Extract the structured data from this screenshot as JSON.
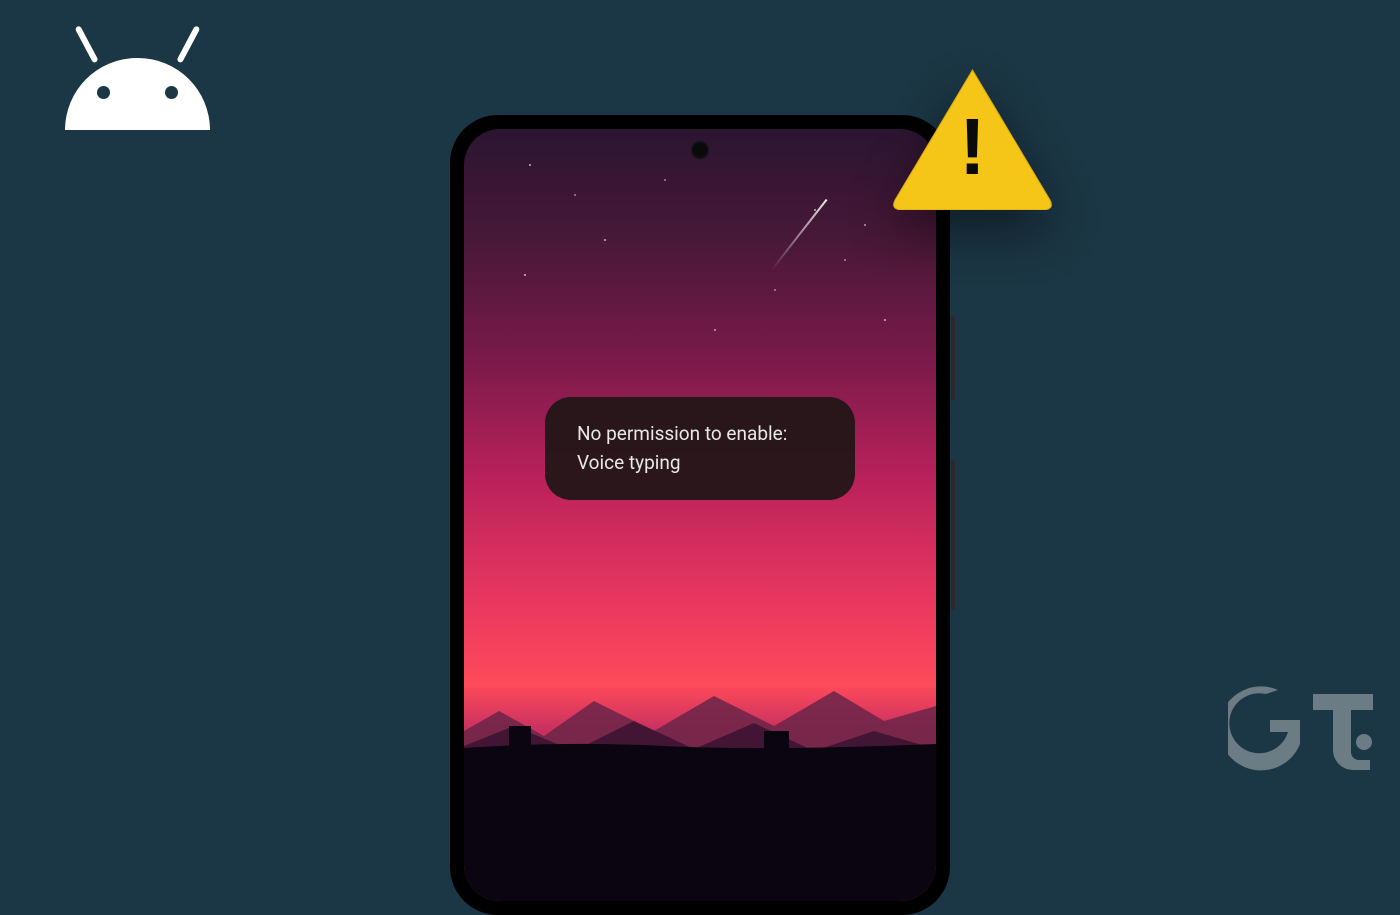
{
  "toast": {
    "line1": "No permission to enable:",
    "line2": "Voice typing"
  },
  "warning": {
    "symbol": "!"
  },
  "watermark": {
    "text": "Gt"
  },
  "colors": {
    "background": "#1b3644",
    "warning_fill": "#f5c518",
    "android_logo": "#ffffff"
  }
}
